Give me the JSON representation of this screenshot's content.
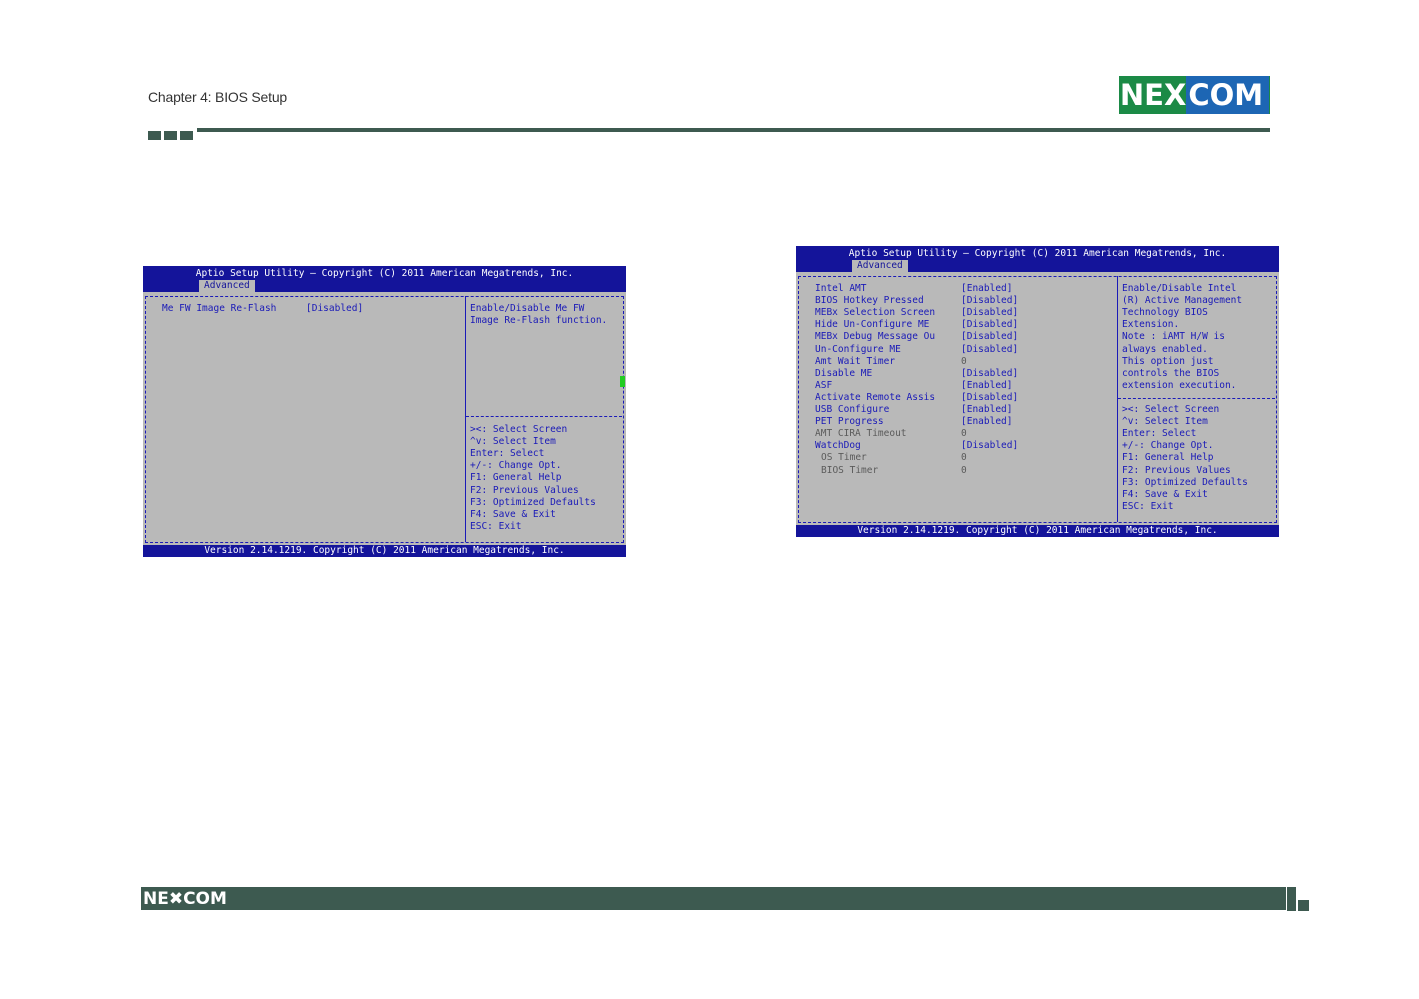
{
  "header": {
    "chapter_title": "Chapter 4: BIOS Setup",
    "logo_text_ne": "NE",
    "logo_text_x": "X",
    "logo_text_com": "COM",
    "brand_colors": {
      "green": "#1b8a46",
      "blue": "#1d66b4",
      "rule": "#3d5a50"
    }
  },
  "bios_left": {
    "title": "Aptio Setup Utility – Copyright (C) 2011 American Megatrends, Inc.",
    "tab": "Advanced",
    "item_label": "Me FW Image Re-Flash",
    "item_value": "[Disabled]",
    "help": [
      "Enable/Disable Me FW",
      "Image Re-Flash function."
    ],
    "keys": [
      "><: Select Screen",
      "^v: Select Item",
      "Enter: Select",
      "+/-: Change Opt.",
      "F1: General Help",
      "F2: Previous Values",
      "F3: Optimized Defaults",
      "F4: Save & Exit",
      "ESC: Exit"
    ],
    "footer": "Version 2.14.1219. Copyright (C) 2011 American Megatrends, Inc."
  },
  "bios_right": {
    "title": "Aptio Setup Utility – Copyright (C) 2011 American Megatrends, Inc.",
    "tab": "Advanced",
    "items": [
      {
        "label": "Intel AMT",
        "value": "[Enabled]"
      },
      {
        "label": "BIOS Hotkey Pressed",
        "value": "[Disabled]"
      },
      {
        "label": "MEBx Selection Screen",
        "value": "[Disabled]"
      },
      {
        "label": "Hide Un-Configure ME",
        "value": "[Disabled]"
      },
      {
        "label": "MEBx Debug Message Ou",
        "value": "[Disabled]"
      },
      {
        "label": "Un-Configure ME",
        "value": "[Disabled]"
      },
      {
        "label": "Amt Wait Timer",
        "value": "0"
      },
      {
        "label": "Disable ME",
        "value": "[Disabled]"
      },
      {
        "label": "ASF",
        "value": "[Enabled]"
      },
      {
        "label": "Activate Remote Assis",
        "value": "[Disabled]"
      },
      {
        "label": "USB Configure",
        "value": "[Enabled]"
      },
      {
        "label": "PET Progress",
        "value": "[Enabled]"
      },
      {
        "label": "AMT CIRA Timeout",
        "value": "0"
      },
      {
        "label": "WatchDog",
        "value": "[Disabled]"
      },
      {
        "label": "OS Timer",
        "value": "0"
      },
      {
        "label": "BIOS Timer",
        "value": "0"
      }
    ],
    "help": [
      "Enable/Disable Intel",
      "(R) Active Management",
      "Technology BIOS",
      "Extension.",
      "Note : iAMT H/W is",
      "always enabled.",
      "This option just",
      "controls the BIOS",
      "extension execution."
    ],
    "keys": [
      "><: Select Screen",
      "^v: Select Item",
      "Enter: Select",
      "+/-: Change Opt.",
      "F1: General Help",
      "F2: Previous Values",
      "F3: Optimized Defaults",
      "F4: Save & Exit",
      "ESC: Exit"
    ],
    "footer": "Version 2.14.1219. Copyright (C) 2011 American Megatrends, Inc."
  },
  "footer": {
    "logo_text": "NE✖COM"
  }
}
